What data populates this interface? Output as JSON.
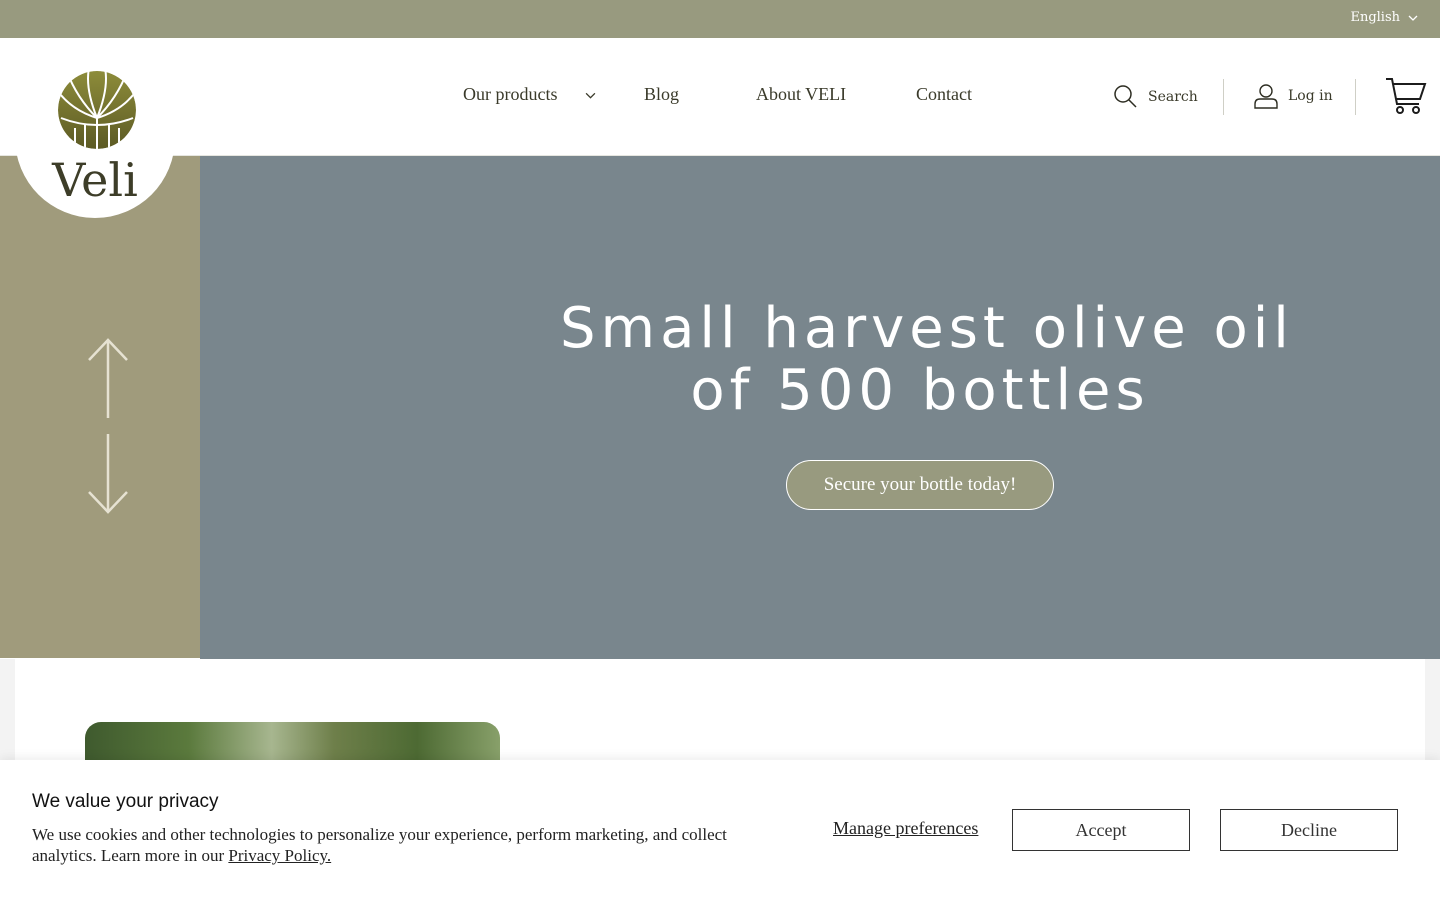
{
  "topbar": {
    "language": "English"
  },
  "brand": {
    "name": "Veli",
    "color_olive": "#989a7f",
    "color_gold": "#8b8a3f",
    "color_slate": "#79868d"
  },
  "nav": {
    "items": [
      {
        "label": "Our products",
        "has_dropdown": true
      },
      {
        "label": "Blog"
      },
      {
        "label": "About VELI"
      },
      {
        "label": "Contact"
      }
    ]
  },
  "header_actions": {
    "search_label": "Search",
    "login_label": "Log in",
    "search_icon": "search-icon",
    "account_icon": "user-icon",
    "cart_icon": "cart-icon"
  },
  "hero": {
    "title_line1": "Small harvest olive oil",
    "title_line2": "of 500 bottles",
    "cta_label": "Secure your bottle today!"
  },
  "cookie": {
    "title": "We value your privacy",
    "text": "We use cookies and other technologies to personalize your experience, perform marketing, and collect analytics. Learn more in our ",
    "policy_link": "Privacy Policy.",
    "manage_label": "Manage preferences",
    "accept_label": "Accept",
    "decline_label": "Decline"
  }
}
